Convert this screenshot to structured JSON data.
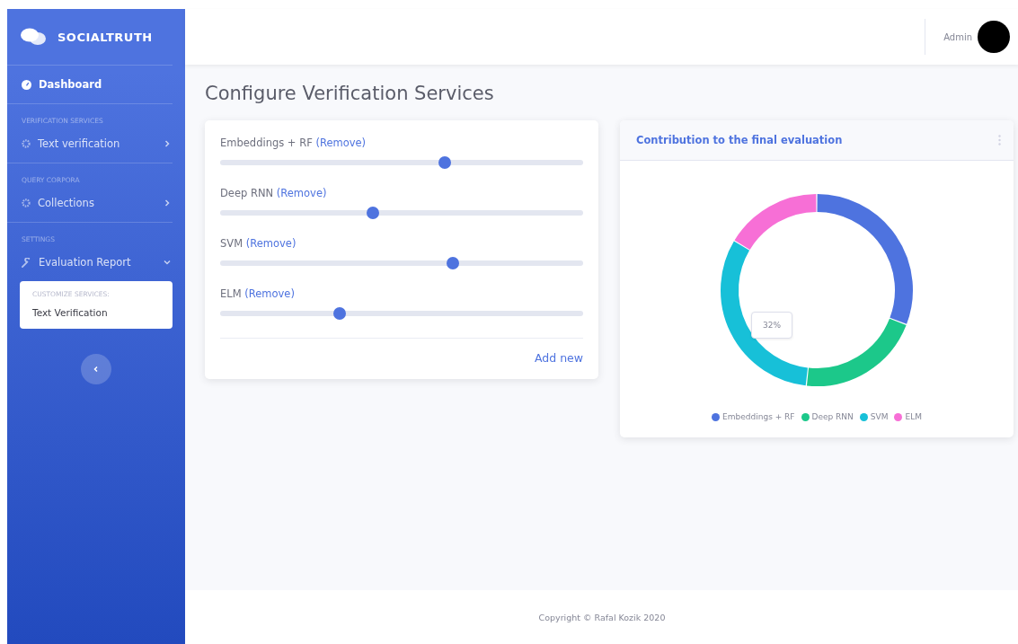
{
  "sidebar": {
    "brand": "SOCIALTRUTH",
    "items": [
      {
        "kind": "link",
        "label": "Dashboard"
      },
      {
        "kind": "heading",
        "label": "VERIFICATION SERVICES"
      },
      {
        "kind": "link",
        "label": "Text verification",
        "expanded": false
      },
      {
        "kind": "heading",
        "label": "QUERY CORPORA"
      },
      {
        "kind": "link",
        "label": "Collections",
        "expanded": false
      },
      {
        "kind": "heading",
        "label": "SETTINGS"
      },
      {
        "kind": "link",
        "label": "Evaluation Report",
        "expanded": true,
        "submenu": {
          "heading": "CUSTOMIZE SERVICES:",
          "items": [
            "Text Verification"
          ]
        }
      }
    ]
  },
  "topbar": {
    "user": "Admin"
  },
  "page_title": "Configure Verification Services",
  "services": [
    {
      "name": "Embeddings + RF",
      "action": "(Remove)",
      "level": 0.62
    },
    {
      "name": "Deep RNN",
      "action": "(Remove)",
      "level": 0.42
    },
    {
      "name": "SVM",
      "action": "(Remove)",
      "level": 0.64
    },
    {
      "name": "ELM",
      "action": "(Remove)",
      "level": 0.33
    }
  ],
  "add_button": "Add new",
  "chart_card": {
    "title": "Contribution to the final evaluation",
    "tooltip": "32%",
    "legend": [
      {
        "label": "Embeddings + RF",
        "color": "#4e73df"
      },
      {
        "label": "Deep RNN",
        "color": "#1cc88a"
      },
      {
        "label": "SVM",
        "color": "#17c0d8"
      },
      {
        "label": "ELM",
        "color": "#f76fd6"
      }
    ]
  },
  "footer": "Copyright © Rafal Kozik 2020"
}
